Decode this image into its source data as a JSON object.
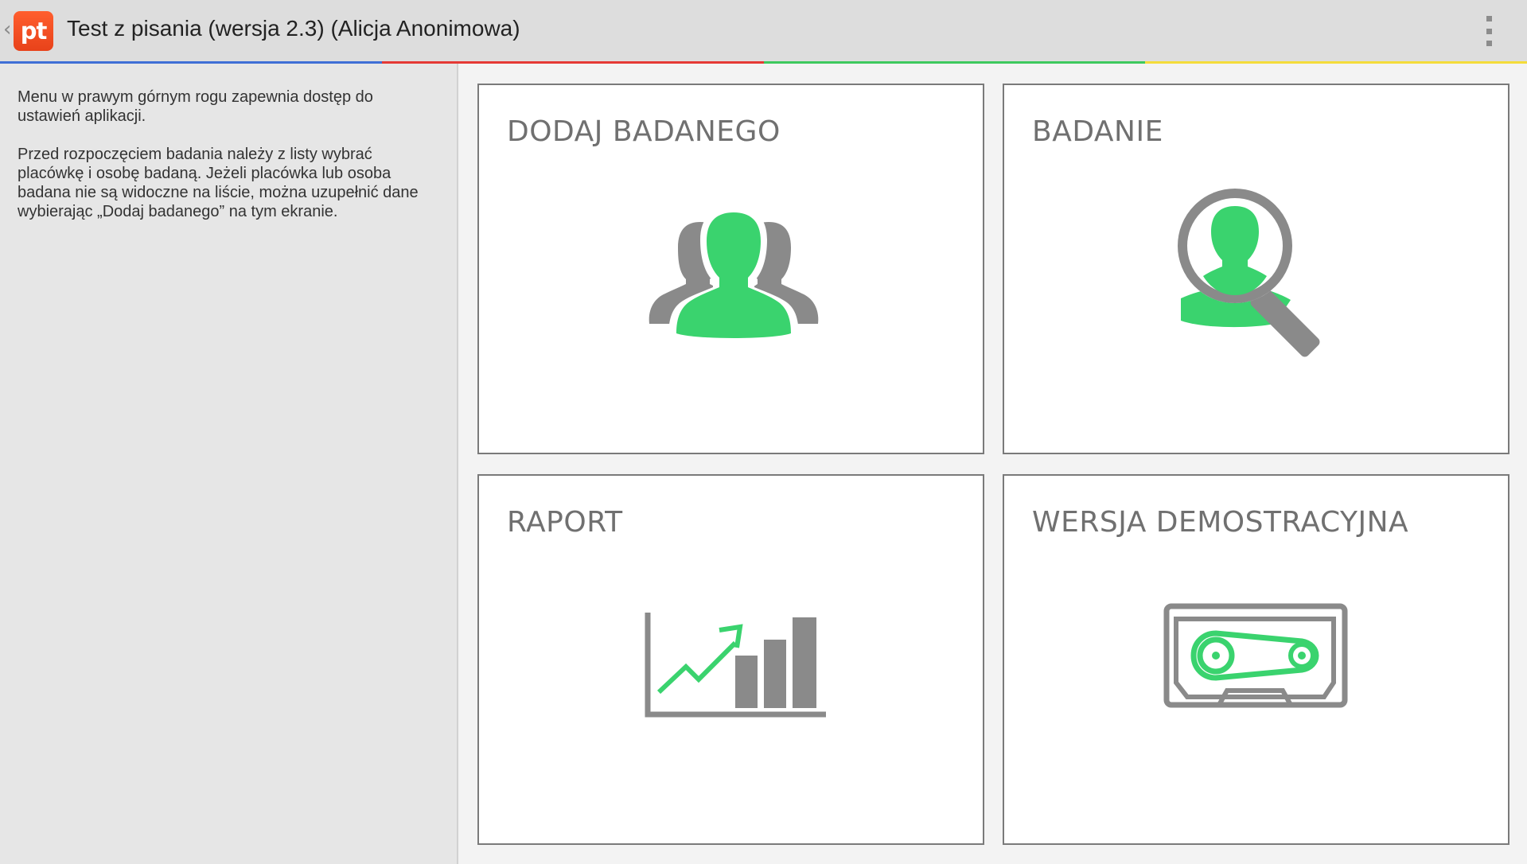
{
  "header": {
    "back_glyph": "‹",
    "logo_text": "pt",
    "title": "Test z pisania (wersja 2.3) (Alicja Anonimowa)",
    "menu_icon": "overflow-menu-icon"
  },
  "accent_colors": [
    "#3f6fd6",
    "#e53935",
    "#3ec95e",
    "#f4dc3a"
  ],
  "sidebar": {
    "paragraph_1": "Menu w prawym górnym rogu zapewnia dostęp do ustawień aplikacji.",
    "paragraph_2": "Przed rozpoczęciem badania należy z listy wybrać placówkę i osobę badaną. Jeżeli placówka lub osoba badana nie są widoczne na liście, można uzupełnić dane wybierając „Dodaj badanego” na tym ekranie."
  },
  "tiles": [
    {
      "label": "DODAJ BADANEGO",
      "icon": "people-group-icon"
    },
    {
      "label": "BADANIE",
      "icon": "person-search-icon"
    },
    {
      "label": "RAPORT",
      "icon": "chart-growth-icon"
    },
    {
      "label": "WERSJA DEMOSTRACYJNA",
      "icon": "cassette-tape-icon"
    }
  ],
  "icon_colors": {
    "green": "#3ad36e",
    "gray": "#8a8a8a"
  }
}
